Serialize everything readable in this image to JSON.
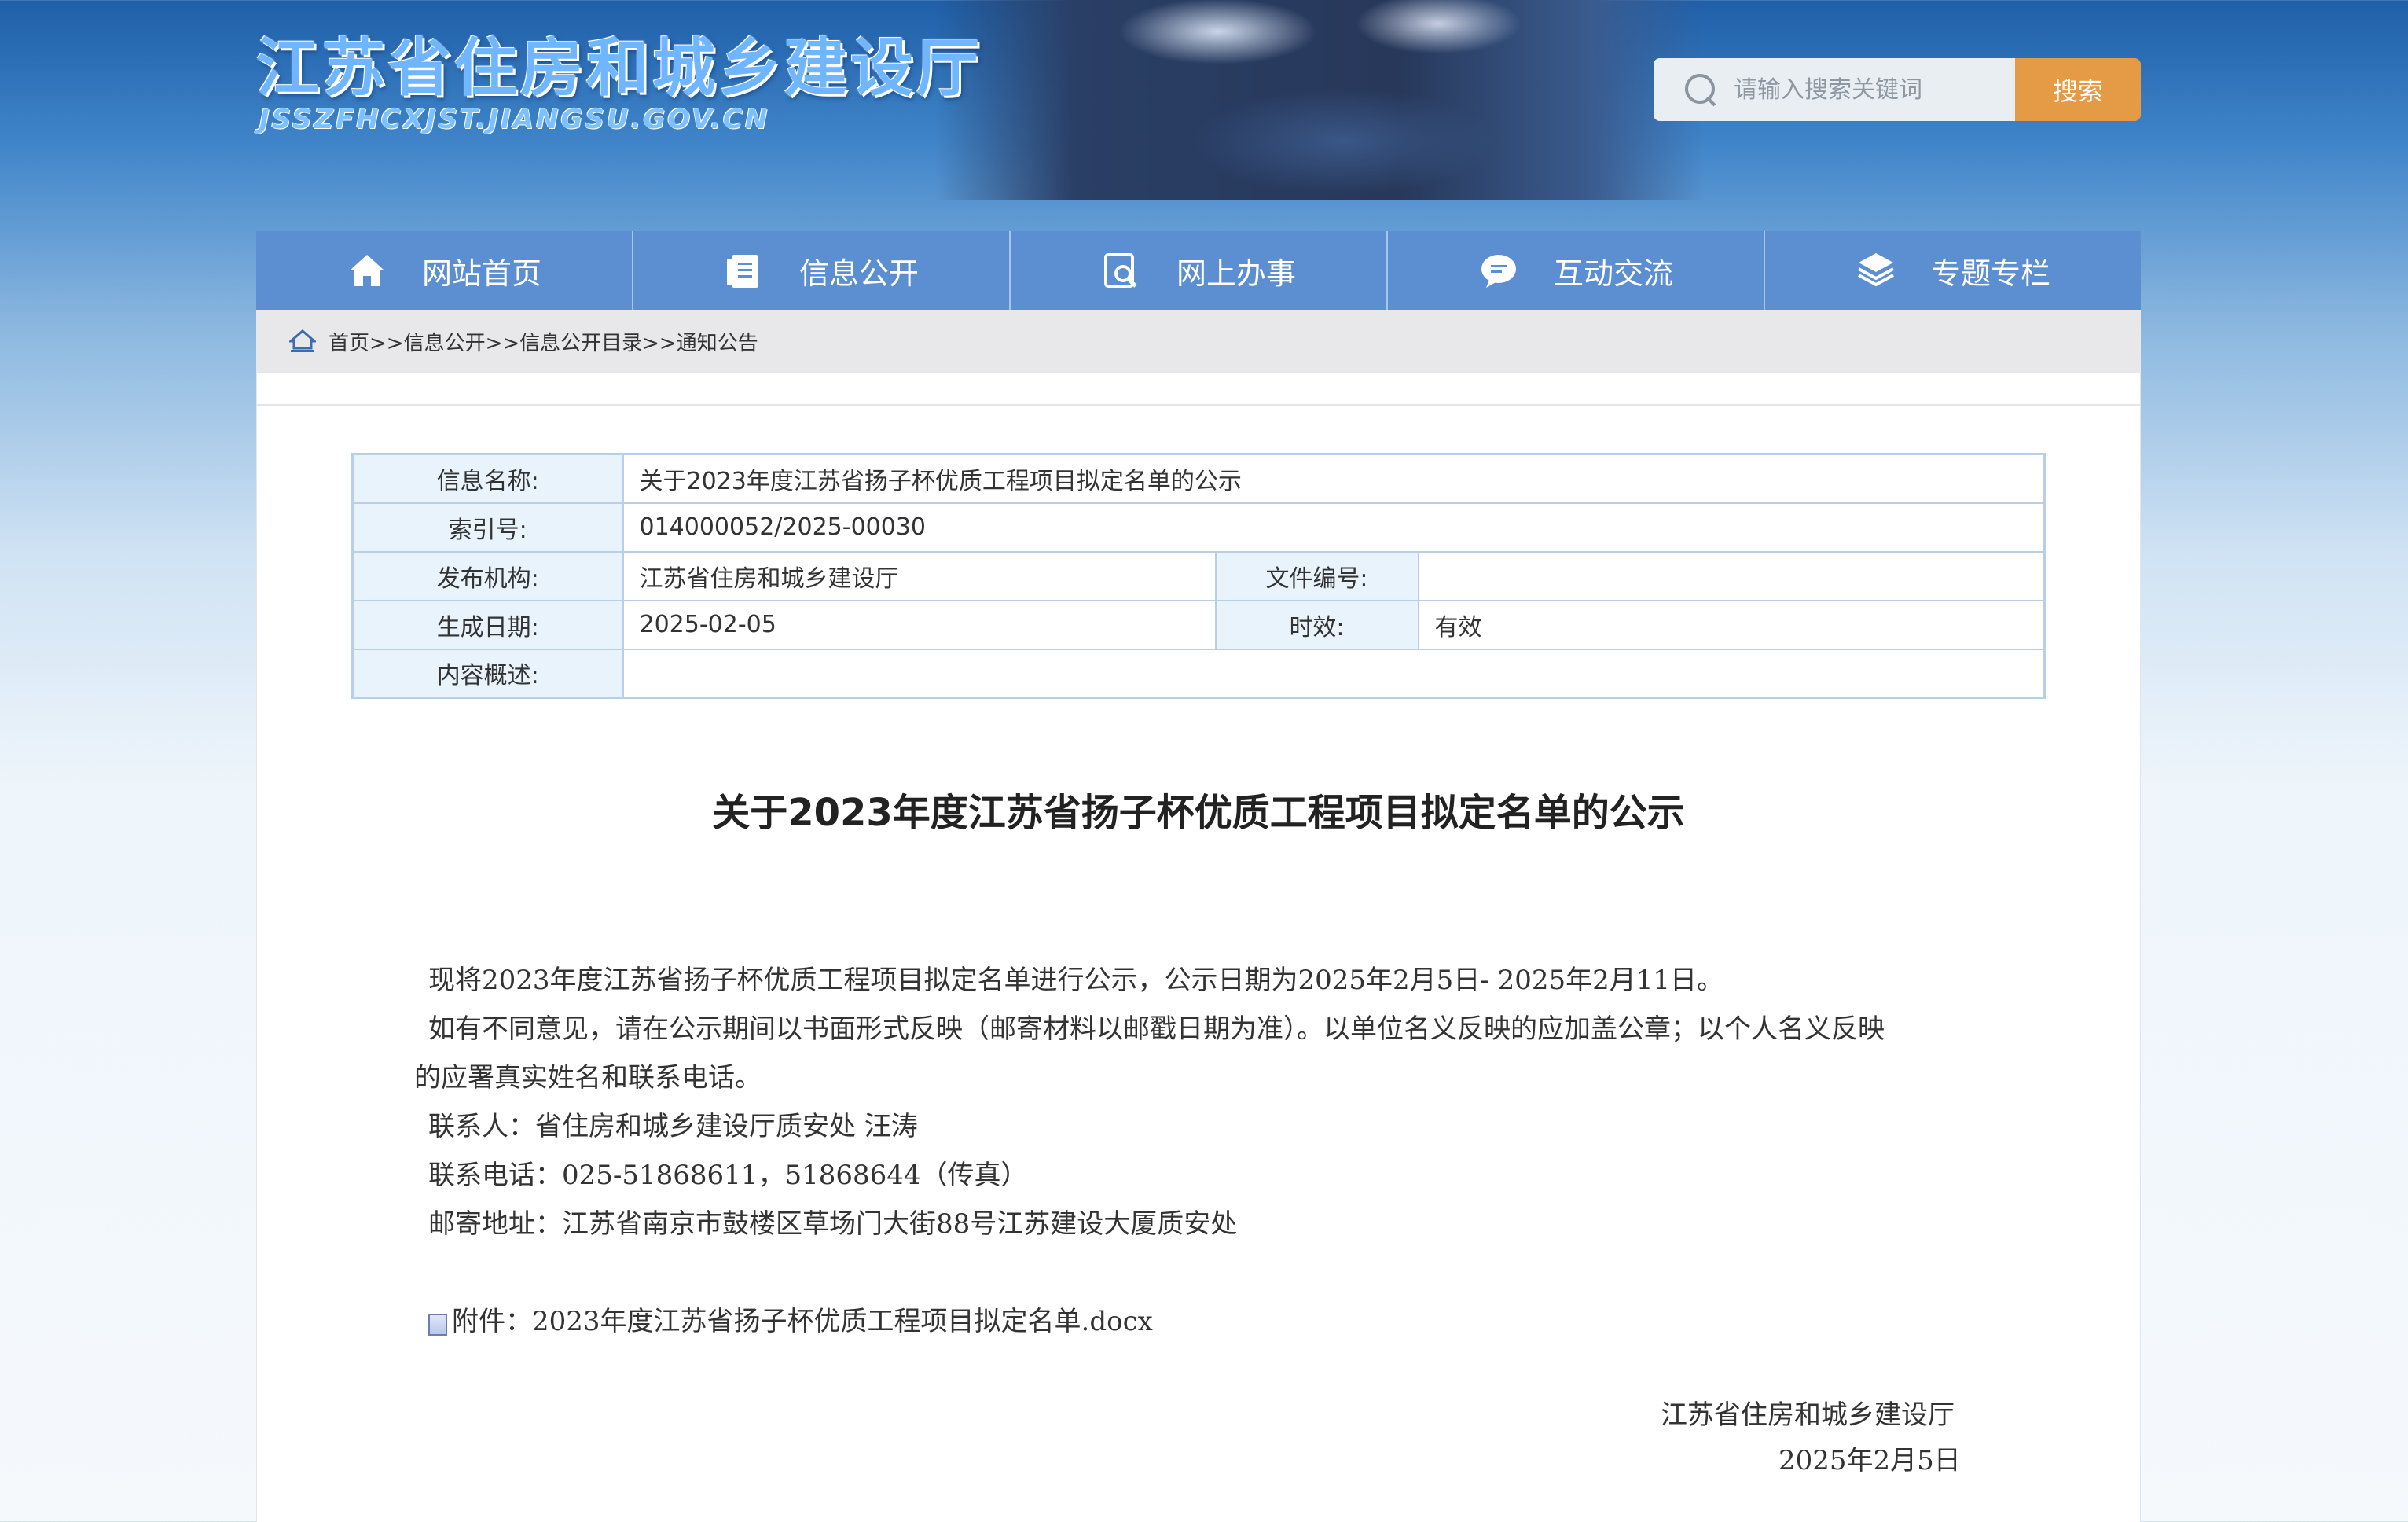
{
  "header": {
    "site_title": "江苏省住房和城乡建设厅",
    "site_domain": "JSSZFHCXJST.JIANGSU.GOV.CN",
    "search_placeholder": "请输入搜索关键词",
    "search_button": "搜索"
  },
  "nav": {
    "items": [
      {
        "label": "网站首页",
        "icon": "home-icon"
      },
      {
        "label": "信息公开",
        "icon": "document-icon"
      },
      {
        "label": "网上办事",
        "icon": "search-document-icon"
      },
      {
        "label": "互动交流",
        "icon": "chat-bubble-icon"
      },
      {
        "label": "专题专栏",
        "icon": "layers-icon"
      }
    ]
  },
  "breadcrumb": {
    "text": "首页>>信息公开>>信息公开目录>>通知公告"
  },
  "meta": {
    "name_label": "信息名称:",
    "name_value": "关于2023年度江苏省扬子杯优质工程项目拟定名单的公示",
    "index_label": "索引号:",
    "index_value": "014000052/2025-00030",
    "publisher_label": "发布机构:",
    "publisher_value": "江苏省住房和城乡建设厅",
    "docno_label": "文件编号:",
    "docno_value": "",
    "date_label": "生成日期:",
    "date_value": "2025-02-05",
    "validity_label": "时效:",
    "validity_value": "有效",
    "summary_label": "内容概述:",
    "summary_value": ""
  },
  "article": {
    "title": "关于2023年度江苏省扬子杯优质工程项目拟定名单的公示",
    "para1": "现将2023年度江苏省扬子杯优质工程项目拟定名单进行公示，公示日期为2025年2月5日-  2025年2月11日。",
    "para2a": "如有不同意见，请在公示期间以书面形式反映（邮寄材料以邮戳日期为准）。以单位名义反映的应加盖公章；以个人名义反映",
    "para2b": "的应署真实姓名和联系电话。",
    "contact": "联系人：省住房和城乡建设厅质安处 汪涛",
    "phone": "联系电话：025-51868611，51868644（传真）",
    "address": "邮寄地址：江苏省南京市鼓楼区草场门大街88号江苏建设大厦质安处",
    "attachment": "附件：2023年度江苏省扬子杯优质工程项目拟定名单.docx",
    "signer": "江苏省住房和城乡建设厅",
    "sign_date": "2025年2月5日"
  },
  "colors": {
    "nav_bg": "#5b8fd1",
    "search_button": "#e59a45",
    "table_label_bg": "#e8f3fc",
    "table_border": "#b9cfe6"
  }
}
